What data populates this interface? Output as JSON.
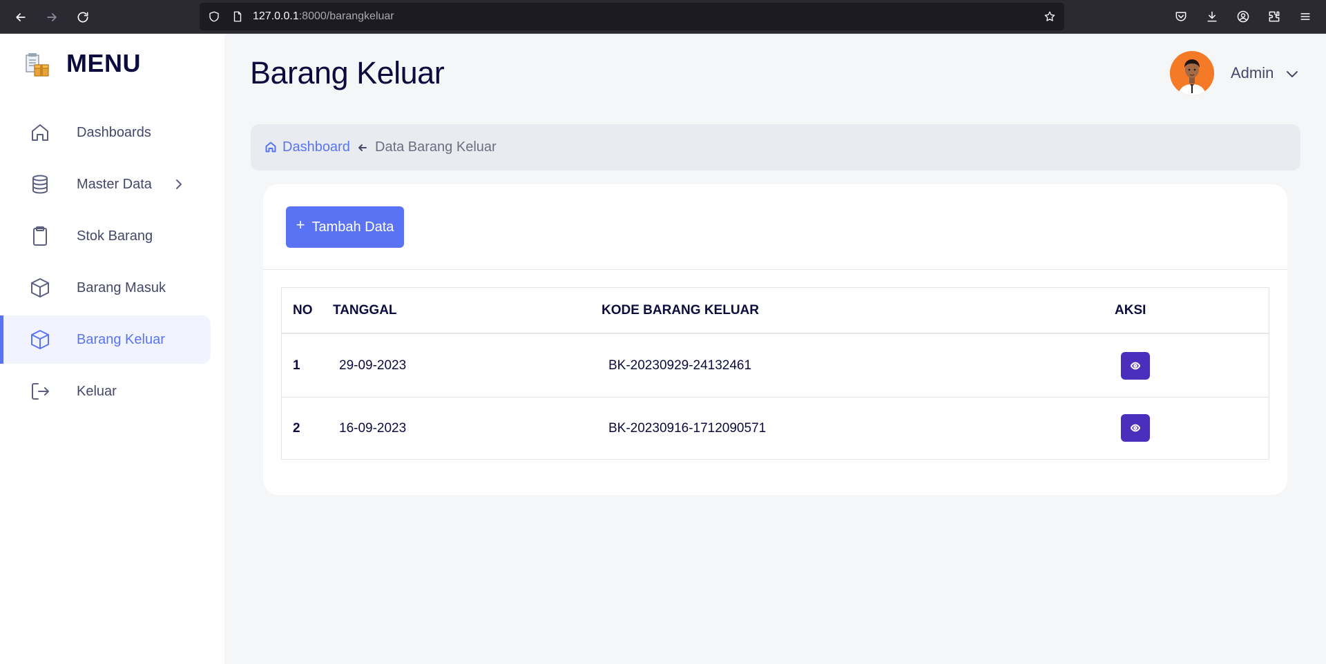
{
  "browser": {
    "url_host": "127.0.0.1",
    "url_path": ":8000/barangkeluar"
  },
  "sidebar": {
    "title": "MENU",
    "items": [
      {
        "label": "Dashboards",
        "icon": "home-icon"
      },
      {
        "label": "Master Data",
        "icon": "database-icon",
        "has_submenu": true
      },
      {
        "label": "Stok Barang",
        "icon": "clipboard-icon"
      },
      {
        "label": "Barang Masuk",
        "icon": "box-icon"
      },
      {
        "label": "Barang Keluar",
        "icon": "box-icon",
        "active": true
      },
      {
        "label": "Keluar",
        "icon": "logout-icon"
      }
    ]
  },
  "header": {
    "title": "Barang Keluar",
    "user_name": "Admin"
  },
  "breadcrumb": {
    "home_label": "Dashboard",
    "current": "Data Barang Keluar"
  },
  "toolbar": {
    "add_label": "Tambah Data"
  },
  "table": {
    "columns": [
      "NO",
      "TANGGAL",
      "KODE BARANG KELUAR",
      "AKSI"
    ],
    "rows": [
      {
        "no": "1",
        "tanggal": "29-09-2023",
        "kode": "BK-20230929-24132461"
      },
      {
        "no": "2",
        "tanggal": "16-09-2023",
        "kode": "BK-20230916-1712090571"
      }
    ]
  },
  "colors": {
    "accent": "#5a73f5",
    "action_button": "#4a2fbd",
    "heading": "#0d0b3d"
  }
}
